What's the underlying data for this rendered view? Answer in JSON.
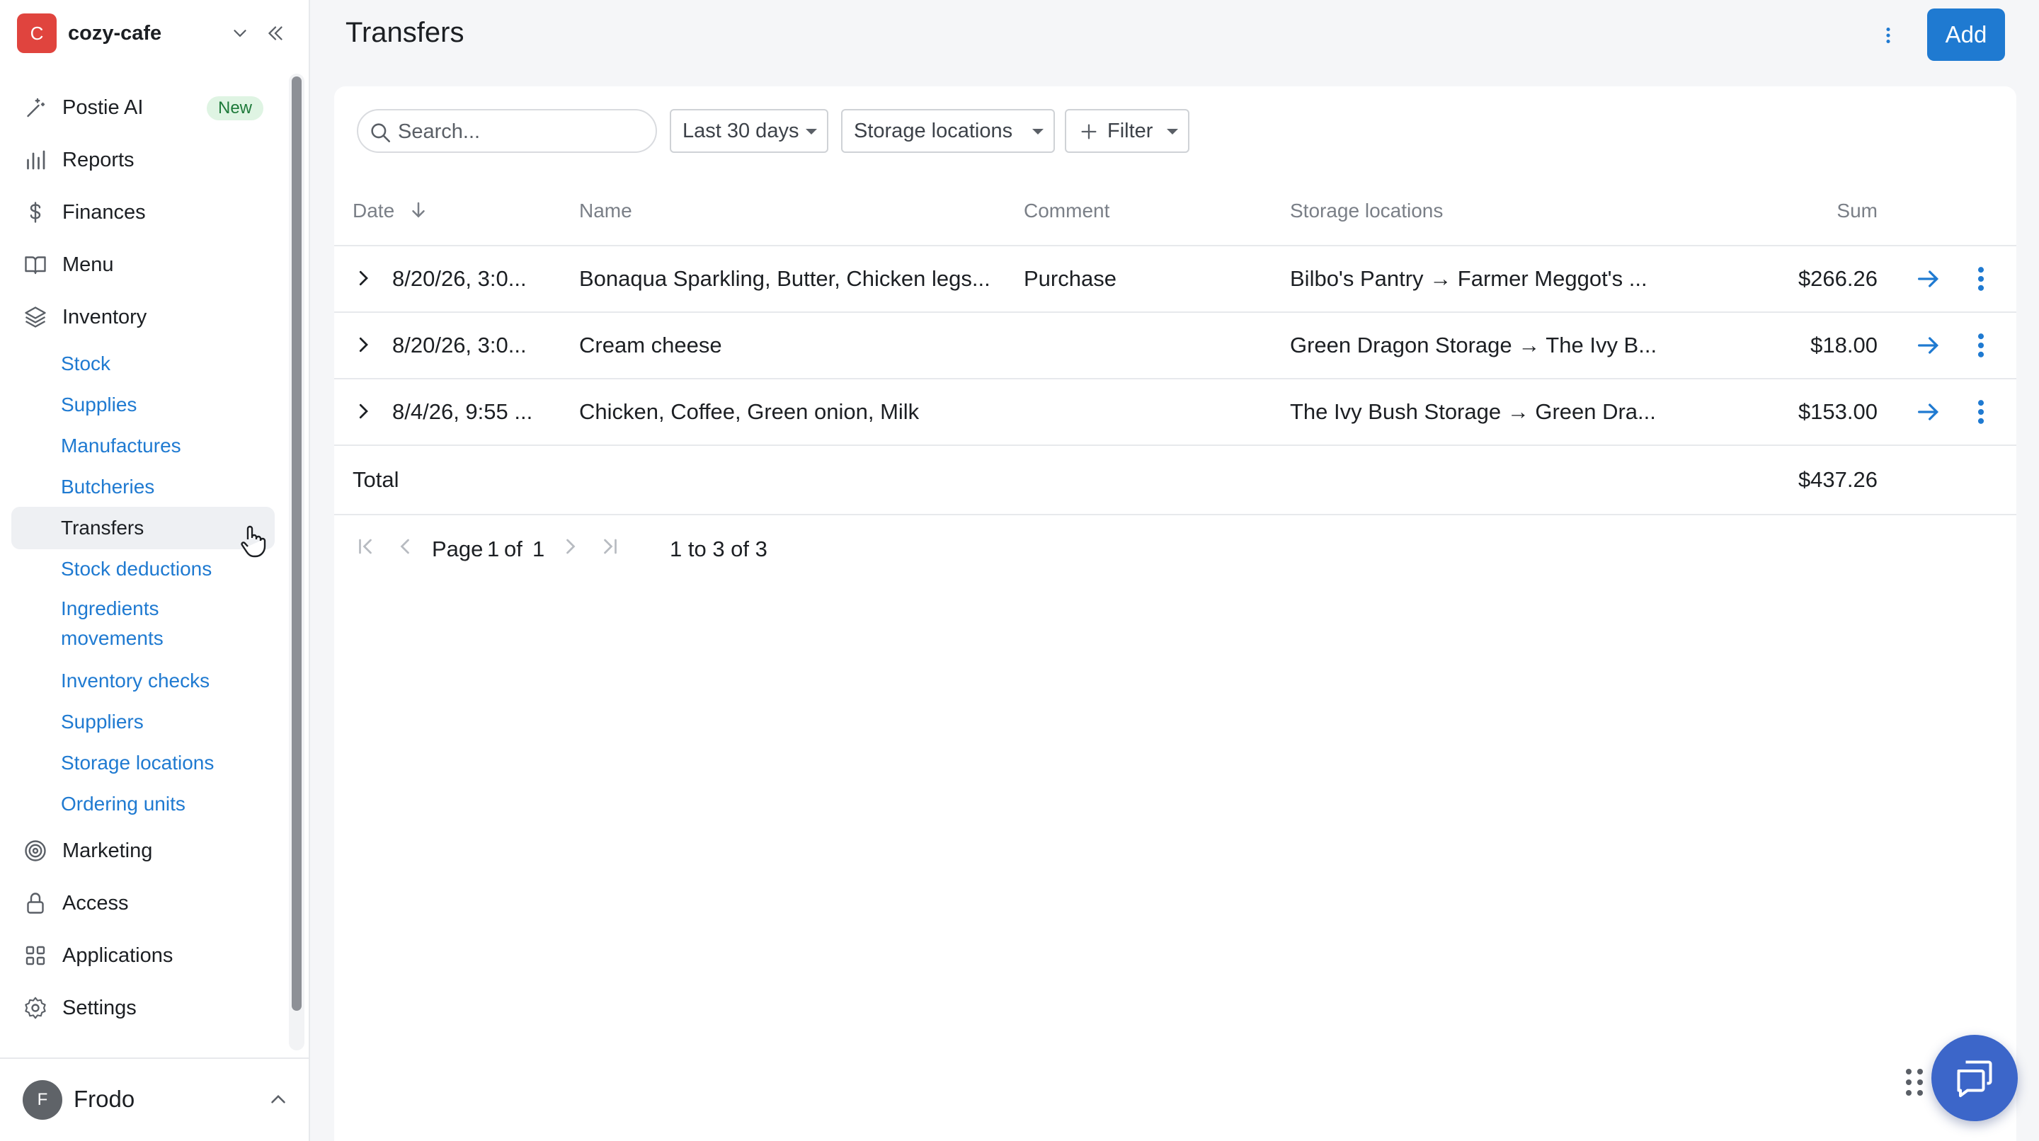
{
  "workspace": {
    "initial": "C",
    "name": "cozy-cafe"
  },
  "nav": [
    {
      "key": "postie",
      "label": "Postie AI",
      "badge": "New",
      "icon": "wand-icon"
    },
    {
      "key": "reports",
      "label": "Reports",
      "icon": "bar-chart-icon"
    },
    {
      "key": "finances",
      "label": "Finances",
      "icon": "dollar-icon"
    },
    {
      "key": "menu",
      "label": "Menu",
      "icon": "book-icon"
    },
    {
      "key": "inventory",
      "label": "Inventory",
      "icon": "layers-icon"
    }
  ],
  "inventory_sub": [
    {
      "label": "Stock"
    },
    {
      "label": "Supplies"
    },
    {
      "label": "Manufactures"
    },
    {
      "label": "Butcheries"
    },
    {
      "label": "Transfers",
      "active": true
    },
    {
      "label": "Stock deductions"
    },
    {
      "label": "Ingredients movements"
    },
    {
      "label": "Inventory checks"
    },
    {
      "label": "Suppliers"
    },
    {
      "label": "Storage locations"
    },
    {
      "label": "Ordering units"
    }
  ],
  "nav_bottom": [
    {
      "key": "marketing",
      "label": "Marketing",
      "icon": "target-icon"
    },
    {
      "key": "access",
      "label": "Access",
      "icon": "lock-icon"
    },
    {
      "key": "applications",
      "label": "Applications",
      "icon": "grid-icon"
    },
    {
      "key": "settings",
      "label": "Settings",
      "icon": "gear-icon"
    }
  ],
  "user": {
    "initial": "F",
    "name": "Frodo"
  },
  "page": {
    "title": "Transfers",
    "add_label": "Add"
  },
  "filters": {
    "search_placeholder": "Search...",
    "period": "Last 30 days",
    "storage": "Storage locations",
    "filter": "Filter"
  },
  "table": {
    "headers": {
      "date": "Date",
      "name": "Name",
      "comment": "Comment",
      "storage": "Storage locations",
      "sum": "Sum"
    },
    "rows": [
      {
        "date": "8/20/26, 3:0...",
        "name": "Bonaqua Sparkling, Butter, Chicken legs...",
        "comment": "Purchase",
        "storage": "Bilbo's Pantry → Farmer Meggot's ...",
        "sum": "$266.26"
      },
      {
        "date": "8/20/26, 3:0...",
        "name": "Cream cheese",
        "comment": "",
        "storage": "Green Dragon Storage → The Ivy B...",
        "sum": "$18.00"
      },
      {
        "date": "8/4/26, 9:55 ...",
        "name": "Chicken, Coffee, Green onion, Milk",
        "comment": "",
        "storage": "The Ivy Bush Storage → Green Dra...",
        "sum": "$153.00"
      }
    ],
    "total_label": "Total",
    "total_sum": "$437.26"
  },
  "pagination": {
    "page_label": "Page",
    "page": "1",
    "of_label": "of",
    "pages": "1",
    "range": "1 to 3 of 3"
  },
  "colors": {
    "accent": "#1f7ad1",
    "workspace_avatar": "#e0443e",
    "chat_button": "#3c66c9"
  }
}
